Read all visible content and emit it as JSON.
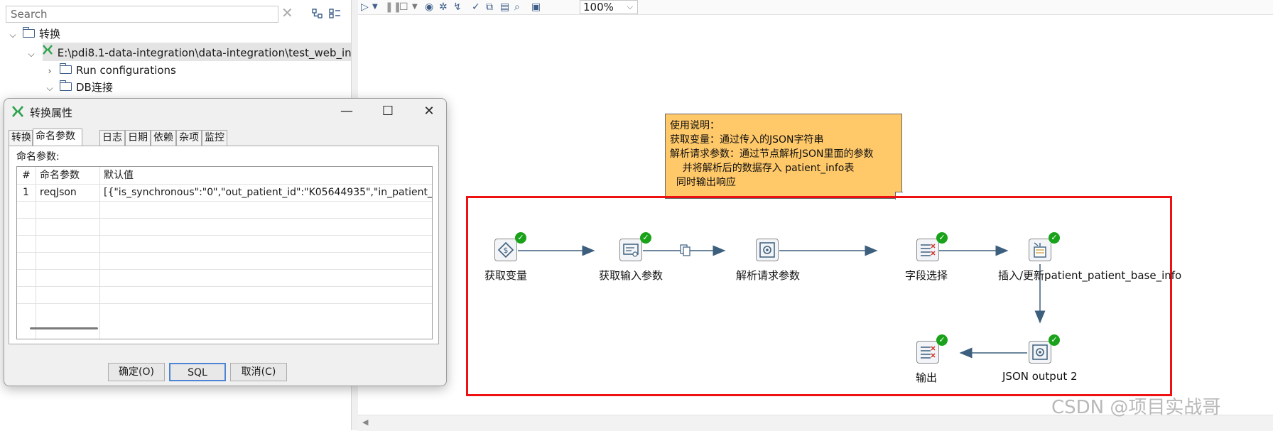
{
  "tree": {
    "search_placeholder": "Search",
    "items": [
      {
        "label": "转换",
        "expanded": true
      },
      {
        "label": "E:\\pdi8.1-data-integration\\data-integration\\test_web_in",
        "expanded": true,
        "selected": true
      },
      {
        "label": "Run configurations",
        "expanded": false
      },
      {
        "label": "DB连接",
        "expanded": true
      }
    ]
  },
  "toolbar": {
    "zoom": "100%"
  },
  "note": {
    "lines": [
      "使用说明：",
      "获取变量：通过传入的JSON字符串",
      "解析请求参数：通过节点解析JSON里面的参数",
      "    并将解析后的数据存入 patient_info表",
      "  同时输出响应"
    ]
  },
  "steps": [
    {
      "label": "获取变量",
      "icon": "variable-icon"
    },
    {
      "label": "获取输入参数",
      "icon": "input-parameter-icon"
    },
    {
      "label": "解析请求参数",
      "icon": "json-parse-icon"
    },
    {
      "label": "字段选择",
      "icon": "select-values-icon"
    },
    {
      "label": "插入/更新patient_patient_base_info",
      "icon": "insert-update-icon"
    },
    {
      "label": "JSON output 2",
      "icon": "json-output-icon"
    },
    {
      "label": "输出",
      "icon": "select-values-icon"
    }
  ],
  "dialog": {
    "title": "转换属性",
    "tabs": [
      "转换",
      "命名参数",
      "日志",
      "日期",
      "依赖",
      "杂项",
      "监控"
    ],
    "active_tab": "命名参数",
    "section_label": "命名参数:",
    "columns": [
      "#",
      "命名参数",
      "默认值"
    ],
    "rows": [
      {
        "num": "1",
        "name": "reqJson",
        "default": "[{\"is_synchronous\":\"0\",\"out_patient_id\":\"K05644935\",\"in_patient_i"
      }
    ],
    "buttons": {
      "ok": "确定(O)",
      "sql": "SQL",
      "cancel": "取消(C)"
    }
  },
  "watermark": "CSDN @项目实战哥",
  "colors": {
    "note_bg": "#ffc869",
    "highlight_border": "#ee1111",
    "status_ok": "#19a21a",
    "hop_line": "#3d5f7e",
    "default_button_border": "#4e84d6"
  }
}
